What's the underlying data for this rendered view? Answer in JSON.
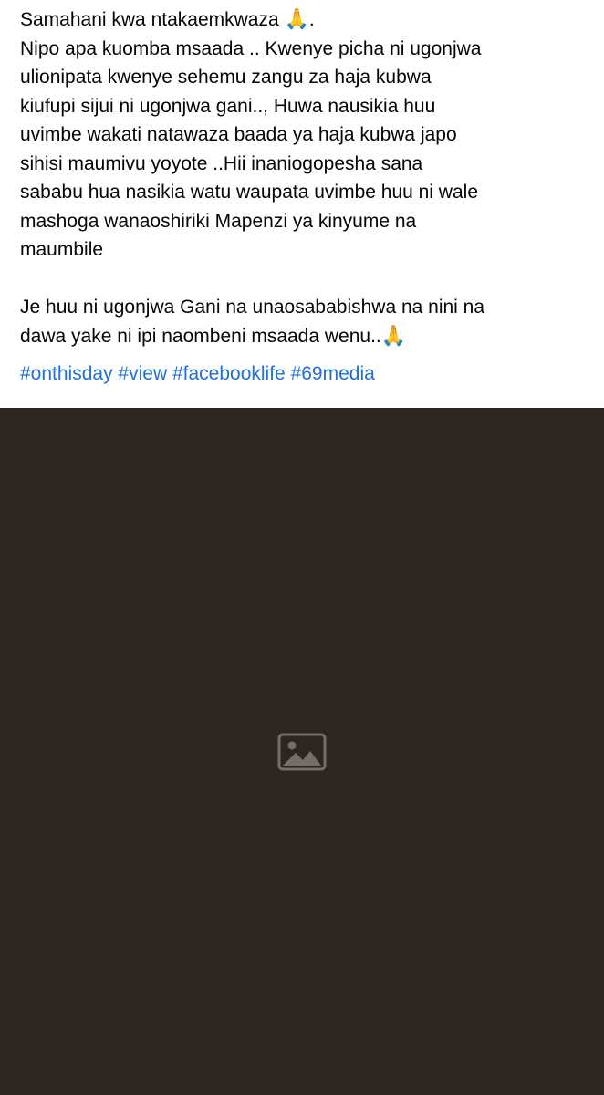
{
  "post": {
    "paragraph1": {
      "line1": "Samahani kwa ntakaemkwaza",
      "line1_emoji": "🙏",
      "line1_tail": ".",
      "line2": "Nipo apa kuomba msaada .. Kwenye picha ni ugonjwa",
      "line3": "ulionipata kwenye sehemu zangu za haja kubwa",
      "line4": "kiufupi sijui ni ugonjwa gani.., Huwa nausikia huu",
      "line5": "uvimbe wakati natawaza baada ya haja kubwa japo",
      "line6": "sihisi maumivu yoyote ..Hii inaniogopesha sana",
      "line7": "sababu hua nasikia watu waupata uvimbe huu ni wale",
      "line8": "mashoga wanaoshiriki Mapenzi ya kinyume na",
      "line9": "maumbile"
    },
    "paragraph2": {
      "line1": "Je huu ni ugonjwa Gani na unaosababishwa na nini na",
      "line2": "dawa yake ni ipi naombeni msaada wenu..",
      "line2_emoji": "🙏"
    },
    "hashtags": [
      "#onthisday",
      "#view",
      "#facebooklife",
      "#69media"
    ],
    "link_color": "#216fdb",
    "photo_icon": "image-icon"
  }
}
